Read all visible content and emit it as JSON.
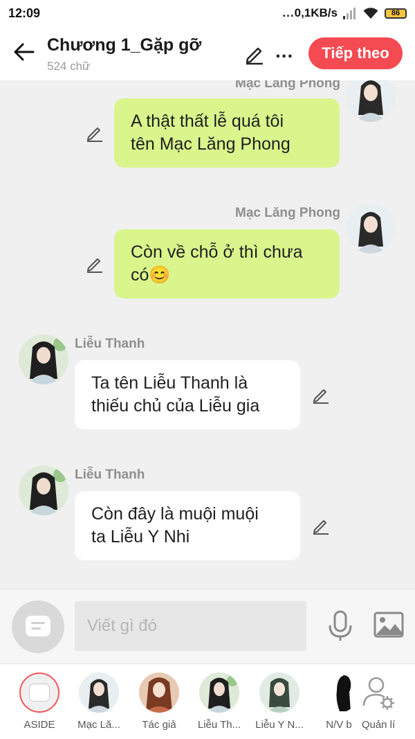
{
  "status_bar": {
    "time": "12:09",
    "dots": "...",
    "network_speed": "0,1KB/s",
    "battery": "86"
  },
  "header": {
    "title": "Chương 1_Gặp gỡ",
    "word_count": "524 chữ",
    "more": "...",
    "next_label": "Tiếp theo"
  },
  "messages": [
    {
      "sender": "Mạc Lăng Phong",
      "side": "right",
      "color": "#d9f58c",
      "lines": [
        "A thật thất lễ quá tôi",
        "tên Mạc Lăng Phong"
      ]
    },
    {
      "sender": "Mạc Lăng Phong",
      "side": "right",
      "color": "#d9f58c",
      "lines": [
        "Còn về chỗ ở thì chưa",
        "có😊"
      ]
    },
    {
      "sender": "Liễu Thanh",
      "side": "left",
      "color": "#ffffff",
      "lines": [
        "Ta tên Liễu Thanh là",
        "thiếu chủ của Liễu gia"
      ]
    },
    {
      "sender": "Liễu Thanh",
      "side": "left",
      "color": "#ffffff",
      "lines": [
        "Còn đây là muội muội",
        "ta Liễu Y Nhi"
      ]
    }
  ],
  "input": {
    "placeholder": "Viết gì đó"
  },
  "characters": [
    {
      "label": "ASIDE",
      "icon": "aside-icon"
    },
    {
      "label": "Mạc Lă...",
      "icon": "avatar"
    },
    {
      "label": "Tác giả",
      "icon": "avatar"
    },
    {
      "label": "Liễu Th...",
      "icon": "avatar"
    },
    {
      "label": "Liễu Y N...",
      "icon": "avatar"
    },
    {
      "label": "N/V b",
      "icon": "silhouette"
    },
    {
      "label": "Quản lí",
      "icon": "user-gear-icon"
    }
  ],
  "colors": {
    "accent": "#f44a52",
    "bubble_self": "#d9f58c",
    "bubble_other": "#ffffff"
  }
}
